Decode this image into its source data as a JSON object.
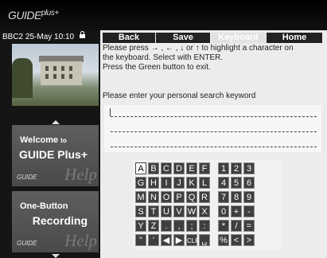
{
  "header": {
    "logo_text": "GUIDE",
    "logo_plus": "plus+"
  },
  "status": {
    "channel": "BBC2",
    "date": "25-May",
    "time": "10:10"
  },
  "menu": [
    {
      "label": "Back",
      "active": false
    },
    {
      "label": "Save",
      "active": false
    },
    {
      "label": "Keyboard",
      "active": true
    },
    {
      "label": "Home",
      "active": false
    }
  ],
  "instructions": [
    "Please press → , ← , ↓ or ↑ to highlight a character on",
    "the keyboard. Select with ENTER.",
    "Press the Green button to exit."
  ],
  "prompt": "Please enter your personal search keyword",
  "search_input": {
    "value": ""
  },
  "promos": [
    {
      "title": "Welcome",
      "title_small": "to",
      "title2": "GUIDE Plus+",
      "help": "Help",
      "logo": "GUIDE"
    },
    {
      "title": "One-Button",
      "title_small": "",
      "title2": "Recording",
      "help": "Help",
      "logo": "GUIDE"
    }
  ],
  "keyboard": {
    "selected": "A",
    "letters": [
      [
        "A",
        "B",
        "C",
        "D",
        "E",
        "F"
      ],
      [
        "G",
        "H",
        "I",
        "J",
        "K",
        "L"
      ],
      [
        "M",
        "N",
        "O",
        "P",
        "Q",
        "R"
      ],
      [
        "S",
        "T",
        "U",
        "V",
        "W",
        "X"
      ],
      [
        "Y",
        "Z",
        ".",
        ",",
        ";",
        ":"
      ],
      [
        "\"",
        "'",
        "◀",
        "▶",
        "CLR",
        "␣"
      ]
    ],
    "digits": [
      [
        "1",
        "2",
        "3"
      ],
      [
        "4",
        "5",
        "6"
      ],
      [
        "7",
        "8",
        "9"
      ],
      [
        "0",
        "+",
        "-"
      ],
      [
        "*",
        "/",
        "="
      ],
      [
        "%",
        "<",
        ">"
      ]
    ]
  }
}
